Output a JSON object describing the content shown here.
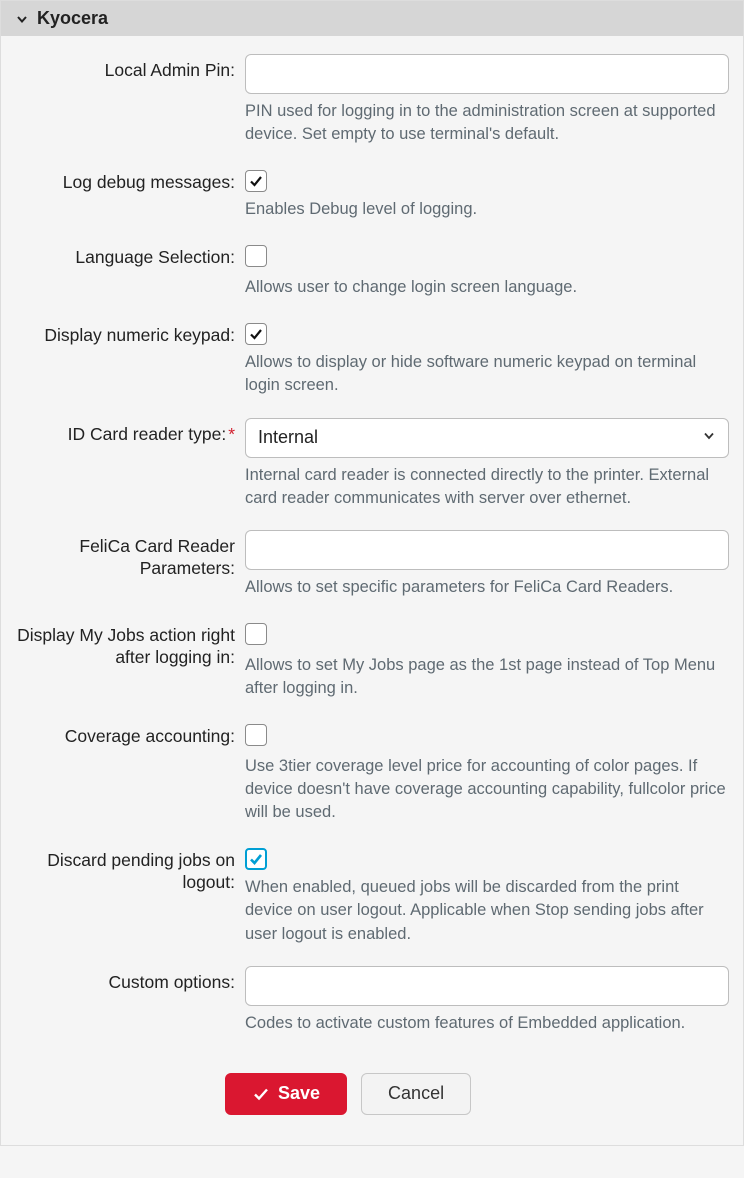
{
  "panel": {
    "title": "Kyocera",
    "expanded": true
  },
  "fields": {
    "localAdminPin": {
      "label": "Local Admin Pin:",
      "value": "",
      "help": "PIN used for logging in to the administration screen at supported device. Set empty to use terminal's default."
    },
    "logDebug": {
      "label": "Log debug messages:",
      "checked": true,
      "help": "Enables Debug level of logging."
    },
    "languageSelection": {
      "label": "Language Selection:",
      "checked": false,
      "help": "Allows user to change login screen language."
    },
    "numericKeypad": {
      "label": "Display numeric keypad:",
      "checked": true,
      "help": "Allows to display or hide software numeric keypad on terminal login screen."
    },
    "cardReaderType": {
      "label": "ID Card reader type:",
      "required": true,
      "value": "Internal",
      "help": "Internal card reader is connected directly to the printer. External card reader communicates with server over ethernet."
    },
    "felica": {
      "label": "FeliCa Card Reader Parameters:",
      "value": "",
      "help": "Allows to set specific parameters for FeliCa Card Readers."
    },
    "myJobs": {
      "label": "Display My Jobs action right after logging in:",
      "checked": false,
      "help": "Allows to set My Jobs page as the 1st page instead of Top Menu after logging in."
    },
    "coverage": {
      "label": "Coverage accounting:",
      "checked": false,
      "help": "Use 3tier coverage level price for accounting of color pages. If device doesn't have coverage accounting capability, fullcolor price will be used."
    },
    "discardPending": {
      "label": "Discard pending jobs on logout:",
      "checked": true,
      "focused": true,
      "help": "When enabled, queued jobs will be discarded from the print device on user logout. Applicable when Stop sending jobs after user logout is enabled."
    },
    "customOptions": {
      "label": "Custom options:",
      "value": "",
      "help": "Codes to activate custom features of Embedded application."
    }
  },
  "buttons": {
    "save": "Save",
    "cancel": "Cancel"
  }
}
